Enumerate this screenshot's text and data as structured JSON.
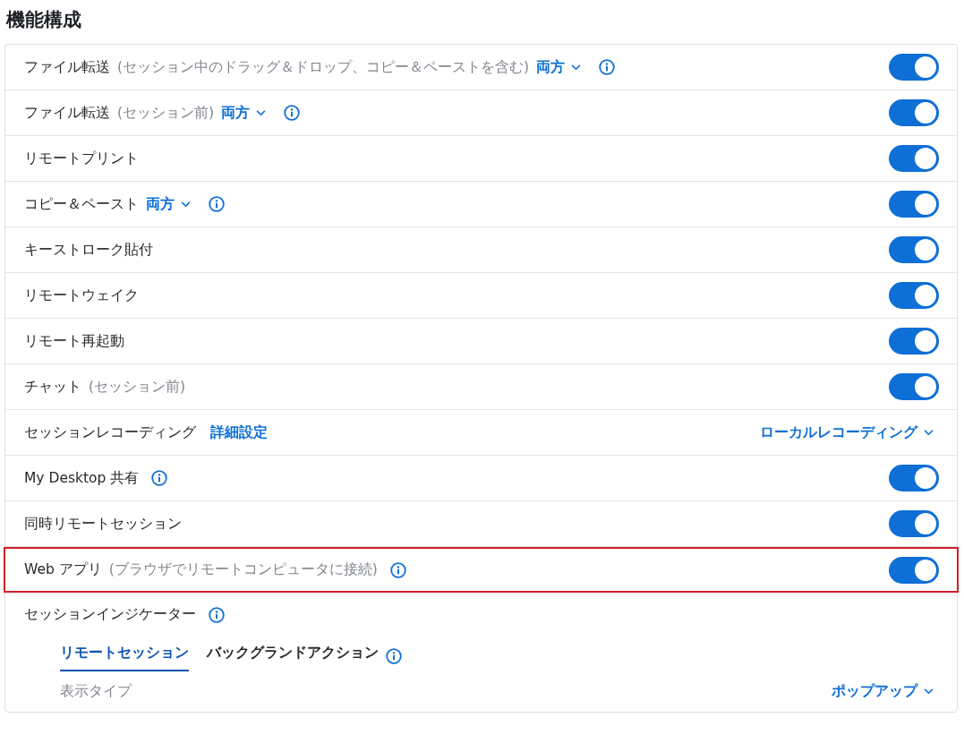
{
  "title": "機能構成",
  "rows": [
    {
      "label": "ファイル転送",
      "note": "(セッション中のドラッグ＆ドロップ、コピー＆ペーストを含む)",
      "dropdown": "両方",
      "info": true,
      "toggle_on": true,
      "highlighted": false
    },
    {
      "label": "ファイル転送",
      "note": "(セッション前)",
      "dropdown": "両方",
      "info": true,
      "toggle_on": true,
      "highlighted": false
    },
    {
      "label": "リモートプリント",
      "info": false,
      "toggle_on": true,
      "highlighted": false
    },
    {
      "label": "コピー＆ペースト",
      "dropdown": "両方",
      "info": true,
      "toggle_on": true,
      "highlighted": false
    },
    {
      "label": "キーストローク貼付",
      "info": false,
      "toggle_on": true,
      "highlighted": false
    },
    {
      "label": "リモートウェイク",
      "info": false,
      "toggle_on": true,
      "highlighted": false
    },
    {
      "label": "リモート再起動",
      "info": false,
      "toggle_on": true,
      "highlighted": false
    },
    {
      "label": "チャット",
      "note": "(セッション前)",
      "info": false,
      "toggle_on": true,
      "highlighted": false
    },
    {
      "label": "セッションレコーディング",
      "link": "詳細設定",
      "info": false,
      "right_dropdown": "ローカルレコーディング",
      "highlighted": false
    },
    {
      "label": "My Desktop 共有",
      "info": true,
      "toggle_on": true,
      "highlighted": false
    },
    {
      "label": "同時リモートセッション",
      "info": false,
      "toggle_on": true,
      "highlighted": false
    },
    {
      "label": "Web アプリ",
      "note": "(ブラウザでリモートコンピュータに接続)",
      "info": true,
      "toggle_on": true,
      "highlighted": true
    }
  ],
  "indicator": {
    "label": "セッションインジケーター",
    "info": true,
    "tabs": [
      {
        "label": "リモートセッション",
        "selected": true,
        "info": false
      },
      {
        "label": "バックグランドアクション",
        "selected": false,
        "info": true
      }
    ],
    "display_type": {
      "label": "表示タイプ",
      "value": "ポップアップ"
    }
  }
}
